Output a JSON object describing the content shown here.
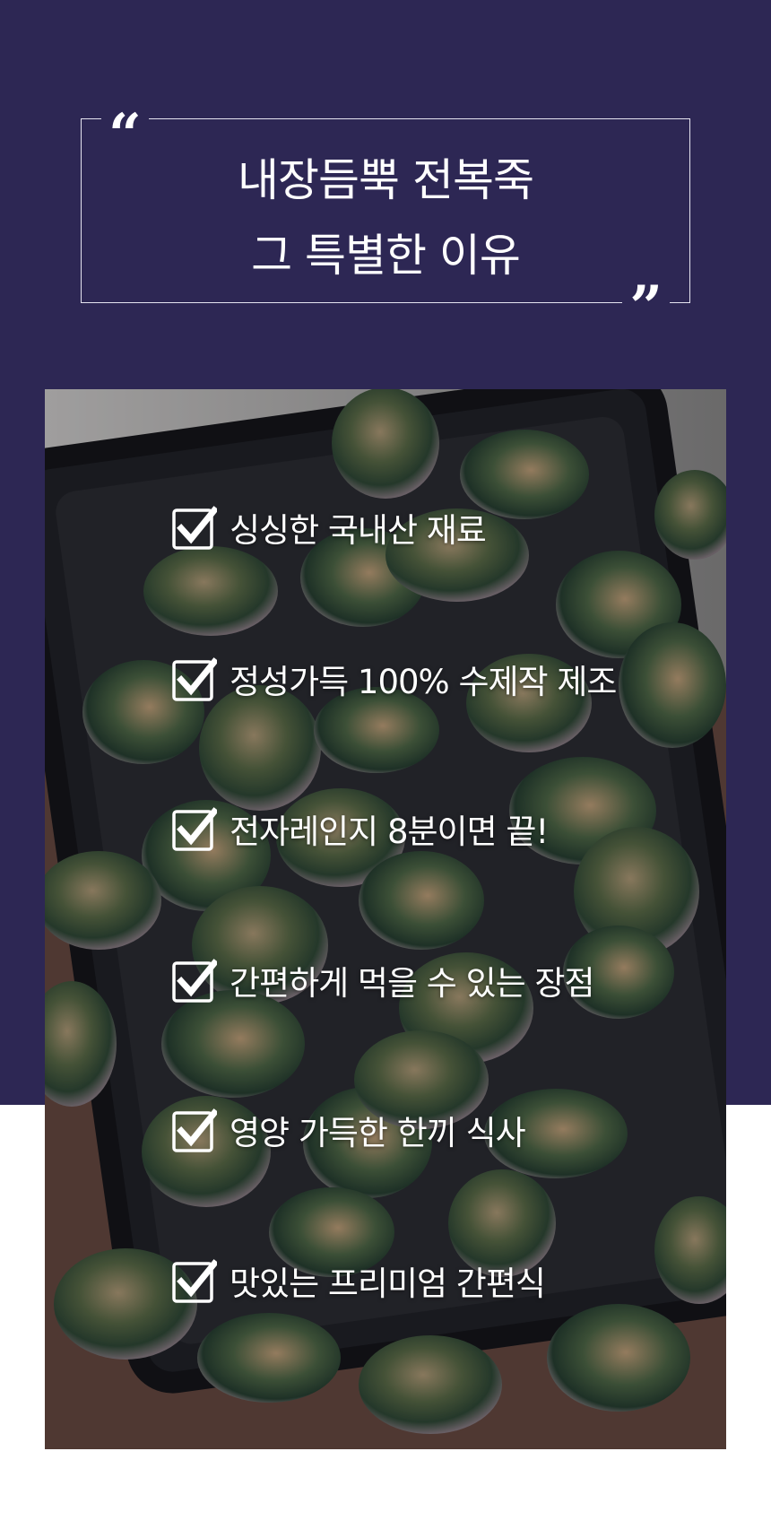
{
  "header": {
    "quote_open": "“",
    "quote_close": "”",
    "title_line1": "내장듬뿍 전복죽",
    "title_line2": "그 특별한 이유"
  },
  "checklist": {
    "items": [
      {
        "label": "싱싱한 국내산 재료",
        "checked": true
      },
      {
        "label": "정성가득 100% 수제작 제조",
        "checked": true
      },
      {
        "label": "전자레인지 8분이면 끝!",
        "checked": true
      },
      {
        "label": "간편하게 먹을 수 있는 장점",
        "checked": true
      },
      {
        "label": "영양 가득한 한끼 식사",
        "checked": true
      },
      {
        "label": "맛있는 프리미엄 간편식",
        "checked": true
      }
    ]
  },
  "colors": {
    "band": "#2d2754",
    "text": "#ffffff"
  },
  "icons": {
    "checkbox": "checkbox-checked-icon",
    "photo": "abalone-tray-photo"
  }
}
